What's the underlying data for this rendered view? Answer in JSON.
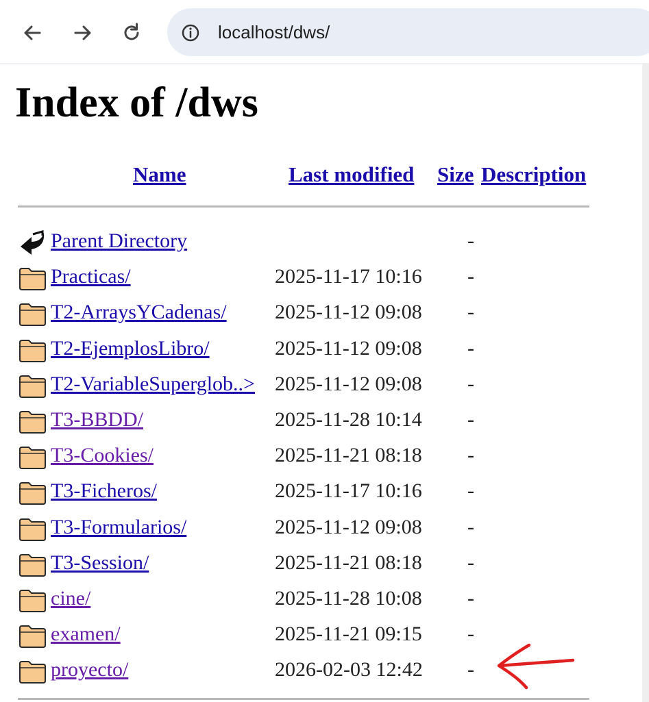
{
  "browser": {
    "url": "localhost/dws/",
    "icons": {
      "back": "arrow-left-icon",
      "forward": "arrow-right-icon",
      "reload": "reload-icon",
      "site_info": "info-circle-icon"
    }
  },
  "page": {
    "title": "Index of /dws",
    "columns": {
      "name": "Name",
      "modified": "Last modified",
      "size": "Size",
      "description": "Description"
    },
    "rows": [
      {
        "name": "Parent Directory",
        "modified": "",
        "size": "-",
        "icon": "back-arrow-icon",
        "visited": false
      },
      {
        "name": "Practicas/",
        "modified": "2025-11-17 10:16",
        "size": "-",
        "icon": "folder-icon",
        "visited": false
      },
      {
        "name": "T2-ArraysYCadenas/",
        "modified": "2025-11-12 09:08",
        "size": "-",
        "icon": "folder-icon",
        "visited": false
      },
      {
        "name": "T2-EjemplosLibro/",
        "modified": "2025-11-12 09:08",
        "size": "-",
        "icon": "folder-icon",
        "visited": false
      },
      {
        "name": "T2-VariableSuperglob..>",
        "modified": "2025-11-12 09:08",
        "size": "-",
        "icon": "folder-icon",
        "visited": false
      },
      {
        "name": "T3-BBDD/",
        "modified": "2025-11-28 10:14",
        "size": "-",
        "icon": "folder-icon",
        "visited": true
      },
      {
        "name": "T3-Cookies/",
        "modified": "2025-11-21 08:18",
        "size": "-",
        "icon": "folder-icon",
        "visited": true
      },
      {
        "name": "T3-Ficheros/",
        "modified": "2025-11-17 10:16",
        "size": "-",
        "icon": "folder-icon",
        "visited": false
      },
      {
        "name": "T3-Formularios/",
        "modified": "2025-11-12 09:08",
        "size": "-",
        "icon": "folder-icon",
        "visited": false
      },
      {
        "name": "T3-Session/",
        "modified": "2025-11-21 08:18",
        "size": "-",
        "icon": "folder-icon",
        "visited": false
      },
      {
        "name": "cine/",
        "modified": "2025-11-28 10:08",
        "size": "-",
        "icon": "folder-icon",
        "visited": true
      },
      {
        "name": "examen/",
        "modified": "2025-11-21 09:15",
        "size": "-",
        "icon": "folder-icon",
        "visited": true
      },
      {
        "name": "proyecto/",
        "modified": "2026-02-03 12:42",
        "size": "-",
        "icon": "folder-icon",
        "visited": true
      }
    ]
  },
  "annotation": {
    "icon": "red-hand-drawn-arrow-icon",
    "color": "#e02020"
  },
  "colors": {
    "link": "#1a0dab",
    "visited_link": "#681da8",
    "omnibox": "#e9eef6"
  }
}
